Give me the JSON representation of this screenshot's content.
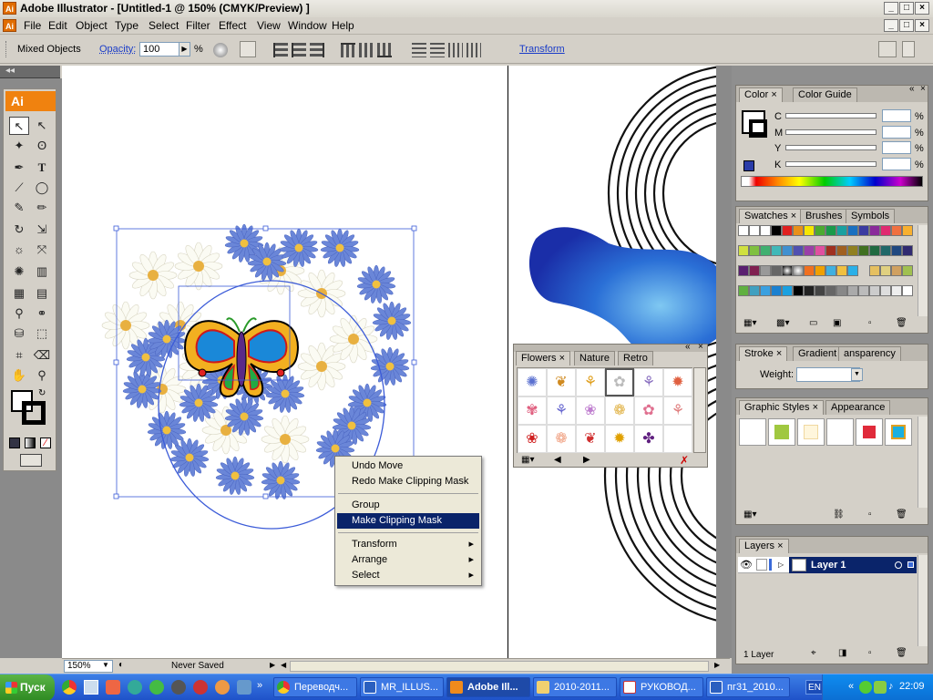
{
  "window": {
    "title": "Adobe Illustrator - [Untitled-1 @ 150% (CMYK/Preview) ]",
    "logo": "Ai"
  },
  "menu": [
    "File",
    "Edit",
    "Object",
    "Type",
    "Select",
    "Filter",
    "Effect",
    "View",
    "Window",
    "Help"
  ],
  "control": {
    "selection_label": "Mixed Objects",
    "opacity_label": "Opacity:",
    "opacity_value": "100",
    "opacity_unit": "%",
    "transform_label": "Transform"
  },
  "toolbox": {
    "logo": "Ai"
  },
  "context_menu": {
    "items": [
      "Undo Move",
      "Redo Make Clipping Mask",
      "Group",
      "Make Clipping Mask",
      "Transform",
      "Arrange",
      "Select"
    ],
    "highlighted": "Make Clipping Mask"
  },
  "status": {
    "zoom": "150%",
    "save_state": "Never Saved"
  },
  "panels": {
    "color": {
      "tabs": [
        "Color",
        "Color Guide"
      ],
      "channels": [
        "C",
        "M",
        "Y",
        "K"
      ],
      "unit": "%"
    },
    "swatches": {
      "tabs": [
        "Swatches",
        "Brushes",
        "Symbols"
      ]
    },
    "stroke": {
      "tabs": [
        "Stroke",
        "Gradient",
        "ansparency"
      ],
      "weight_label": "Weight:"
    },
    "graphic_styles": {
      "tabs": [
        "Graphic Styles",
        "Appearance"
      ]
    },
    "layers": {
      "tabs": [
        "Layers"
      ],
      "layer_name": "Layer 1",
      "count": "1 Layer"
    }
  },
  "flowers_panel": {
    "tabs": [
      "Flowers",
      "Nature",
      "Retro"
    ]
  },
  "taskbar": {
    "start": "Пуск",
    "buttons": [
      "Переводч...",
      "MR_ILLUS...",
      "Adobe Ill...",
      "2010-2011...",
      "РУКОВОД...",
      "пг31_2010..."
    ],
    "active": "Adobe Ill...",
    "lang": "EN",
    "clock": "22:09"
  },
  "colors": {
    "menu_highlight": "#0a246a",
    "illustrator_orange": "#f0820f",
    "selection_blue": "#3b5bd8",
    "xp_taskbar": "#245edb"
  }
}
